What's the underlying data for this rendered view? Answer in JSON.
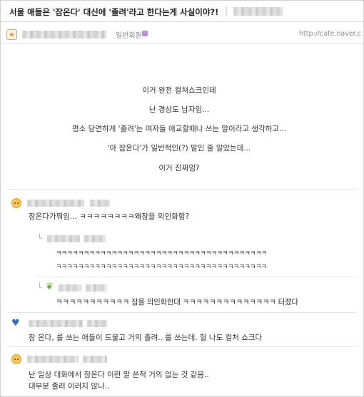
{
  "title": "서울 애들은 '잠온다' 대신에 '졸려'라고 한다는게 사실이야?!",
  "title_separator": "|",
  "author": {
    "grade": "일반회원",
    "url": "http://cafe.naver.c"
  },
  "post_lines": [
    "이거 완전 컬쳐쇼크인데",
    "난 경상도 남자임...",
    "평소 당연하게 '졸려'는 여자들 애교할때나 쓰는 말이라고 생각하고...",
    "'아 잠온다'가 일반적인(?) 말인 줄 알았는데...",
    "이거 진짜임?"
  ],
  "comments": [
    {
      "text": "잠온다가뭐임...  ㅋㅋㅋㅋㅋㅋㅋㅋ왜잠을 의인화함?",
      "avatar_icon": "smiley-face-icon"
    },
    {
      "text": "ㅋㅋㅋㅋㅋㅋㅋㅋㅋㅋㅋㅋㅋㅋㅋㅋㅋㅋㅋㅋㅋㅋㅋㅋㅋㅋㅋㅋㅋㅋㅋㅋㅋㅋㅋㅋㅋㅋ",
      "text2": "ㅋㅋㅋㅋㅋㅋㅋㅋㅋㅋㅋㅋㅋㅋㅋㅋㅋㅋㅋㅋㅋㅋㅋㅋㅋㅋㅋㅋㅋㅋㅋㅋㅋㅋㅋㅋㅋㅋ",
      "reply_icon": "reply-arrow-icon"
    },
    {
      "text": "ㅋㅋㅋㅋㅋㅋㅋㅋㅋㅋㅋ 잠을 의인화한대 ㅋㅋㅋㅋㅋㅋㅋㅋㅋㅋㅋㅋㅋㅋ 터졌다",
      "avatar_icon": "leaf-icon"
    },
    {
      "text": "잠 온다, 를 쓰는 애들이 드물고 거의 졸려.. 를 쓰는데. 헐 나도 컬처 쇼크다",
      "avatar_icon": "heart-icon"
    },
    {
      "text": "난 일상 대화에서 잠온다 이런 말 쓴적 거의 없는 것 같음..",
      "text2": "대부분 졸려 이러지 않나..",
      "avatar_icon": "smiley-face-icon"
    }
  ]
}
